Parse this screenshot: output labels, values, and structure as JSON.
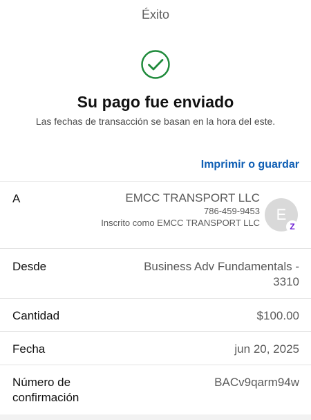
{
  "header": {
    "title": "Éxito"
  },
  "status": {
    "icon": "check-circle-icon",
    "icon_color": "#1f8a3b",
    "headline": "Su pago fue enviado",
    "note": "Las fechas de transacción se basan en la hora del este."
  },
  "actions": {
    "print_save": "Imprimir o guardar",
    "link_color": "#0e5eb4"
  },
  "details": {
    "recipient": {
      "label": "A",
      "name": "EMCC TRANSPORT LLC",
      "phone": "786-459-9453",
      "registered_as": "Inscrito como EMCC TRANSPORT LLC",
      "avatar_letter": "E",
      "badge_icon": "zelle-icon",
      "badge_glyph": "Z",
      "badge_color": "#6d1ed4"
    },
    "from": {
      "label": "Desde",
      "value": "Business Adv Fundamentals - 3310"
    },
    "amount": {
      "label": "Cantidad",
      "value": "$100.00"
    },
    "date": {
      "label": "Fecha",
      "value": "jun 20, 2025"
    },
    "confirmation": {
      "label": "Número de confirmación",
      "value": "BACv9qarm94w"
    }
  }
}
